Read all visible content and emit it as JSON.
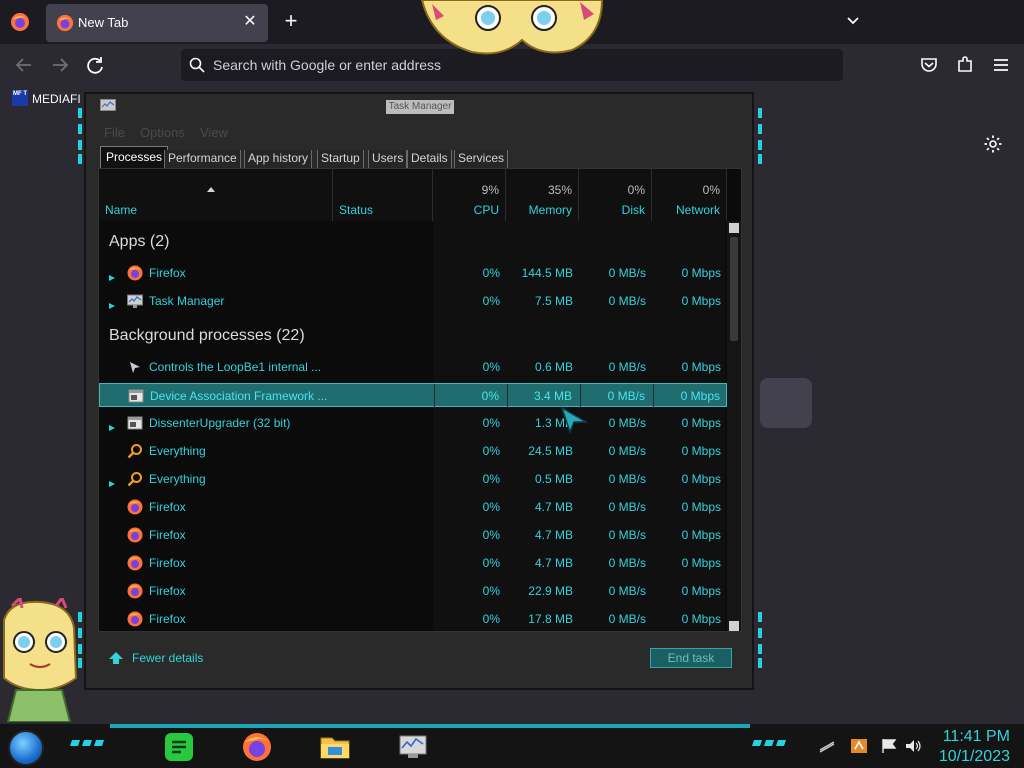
{
  "browser": {
    "tab_title": "New Tab",
    "url_placeholder": "Search with Google or enter address",
    "bookmark_label": "MEDIAFI",
    "bookmark_icon_text": "MF T"
  },
  "taskmanager": {
    "title": "Task Manager",
    "menu": [
      "File",
      "Options",
      "View"
    ],
    "tabs": [
      "Processes",
      "Performance",
      "App history",
      "Startup",
      "Users",
      "Details",
      "Services"
    ],
    "columns": {
      "name": "Name",
      "status": "Status",
      "cpu": {
        "pct": "9%",
        "label": "CPU"
      },
      "memory": {
        "pct": "35%",
        "label": "Memory"
      },
      "disk": {
        "pct": "0%",
        "label": "Disk"
      },
      "network": {
        "pct": "0%",
        "label": "Network"
      }
    },
    "groups": [
      {
        "label": "Apps (2)"
      },
      {
        "label": "Background processes (22)"
      }
    ],
    "apps": [
      {
        "name": "Firefox",
        "cpu": "0%",
        "memory": "144.5 MB",
        "disk": "0 MB/s",
        "network": "0 Mbps",
        "icon": "firefox-icon",
        "expand": true
      },
      {
        "name": "Task Manager",
        "cpu": "0%",
        "memory": "7.5 MB",
        "disk": "0 MB/s",
        "network": "0 Mbps",
        "icon": "task-manager-icon",
        "expand": true
      }
    ],
    "background": [
      {
        "name": "Controls the LoopBe1 internal ...",
        "cpu": "0%",
        "memory": "0.6 MB",
        "disk": "0 MB/s",
        "network": "0 Mbps",
        "icon": "loopbe-icon",
        "expand": false
      },
      {
        "name": "Device Association Framework ...",
        "cpu": "0%",
        "memory": "3.4 MB",
        "disk": "0 MB/s",
        "network": "0 Mbps",
        "icon": "service-window-icon",
        "expand": false,
        "selected": true
      },
      {
        "name": "DissenterUpgrader (32 bit)",
        "cpu": "0%",
        "memory": "1.3 MB",
        "disk": "0 MB/s",
        "network": "0 Mbps",
        "icon": "service-window-icon",
        "expand": true
      },
      {
        "name": "Everything",
        "cpu": "0%",
        "memory": "24.5 MB",
        "disk": "0 MB/s",
        "network": "0 Mbps",
        "icon": "everything-search-icon",
        "expand": false
      },
      {
        "name": "Everything",
        "cpu": "0%",
        "memory": "0.5 MB",
        "disk": "0 MB/s",
        "network": "0 Mbps",
        "icon": "everything-search-icon",
        "expand": true
      },
      {
        "name": "Firefox",
        "cpu": "0%",
        "memory": "4.7 MB",
        "disk": "0 MB/s",
        "network": "0 Mbps",
        "icon": "firefox-icon",
        "expand": false
      },
      {
        "name": "Firefox",
        "cpu": "0%",
        "memory": "4.7 MB",
        "disk": "0 MB/s",
        "network": "0 Mbps",
        "icon": "firefox-icon",
        "expand": false
      },
      {
        "name": "Firefox",
        "cpu": "0%",
        "memory": "4.7 MB",
        "disk": "0 MB/s",
        "network": "0 Mbps",
        "icon": "firefox-icon",
        "expand": false
      },
      {
        "name": "Firefox",
        "cpu": "0%",
        "memory": "22.9 MB",
        "disk": "0 MB/s",
        "network": "0 Mbps",
        "icon": "firefox-icon",
        "expand": false
      },
      {
        "name": "Firefox",
        "cpu": "0%",
        "memory": "17.8 MB",
        "disk": "0 MB/s",
        "network": "0 Mbps",
        "icon": "firefox-icon",
        "expand": false
      }
    ],
    "fewer_details": "Fewer details",
    "end_task": "End task"
  },
  "taskbar": {
    "time": "11:41 PM",
    "date": "10/1/2023",
    "pinned": [
      "notes-app-icon",
      "firefox-icon",
      "file-explorer-icon",
      "task-manager-icon"
    ],
    "tray": [
      "show-hidden-icons",
      "app-tray-icon",
      "flag-icon",
      "volume-icon"
    ]
  },
  "colors": {
    "accent": "#33d2dd",
    "selected_row": "#1f6d6f",
    "browser_bg": "#2b2a33"
  }
}
